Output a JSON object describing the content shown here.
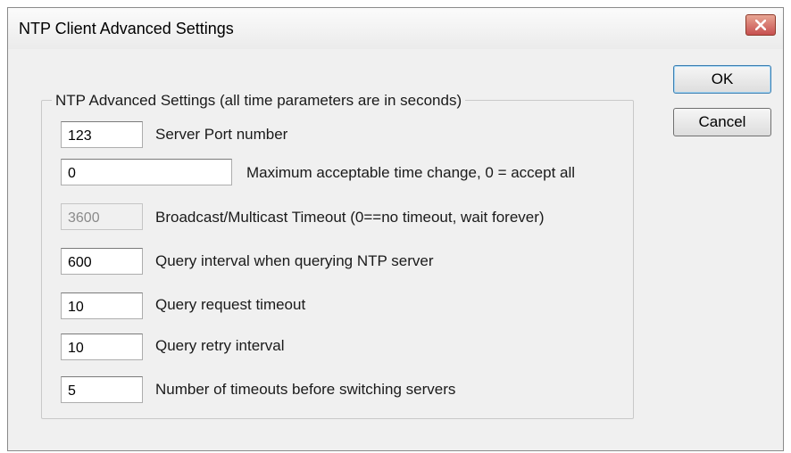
{
  "window": {
    "title": "NTP Client Advanced Settings"
  },
  "buttons": {
    "ok": "OK",
    "cancel": "Cancel"
  },
  "group": {
    "legend": "NTP Advanced Settings (all time parameters are in seconds)"
  },
  "fields": [
    {
      "value": "123",
      "label": "Server Port number",
      "enabled": true
    },
    {
      "value": "0",
      "label": "Maximum acceptable time change, 0 = accept all",
      "enabled": true
    },
    {
      "value": "3600",
      "label": "Broadcast/Multicast Timeout (0==no timeout, wait forever)",
      "enabled": false
    },
    {
      "value": "600",
      "label": "Query interval when querying NTP server",
      "enabled": true
    },
    {
      "value": "10",
      "label": "Query request timeout",
      "enabled": true
    },
    {
      "value": "10",
      "label": "Query retry interval",
      "enabled": true
    },
    {
      "value": "5",
      "label": "Number of timeouts before switching servers",
      "enabled": true
    }
  ]
}
